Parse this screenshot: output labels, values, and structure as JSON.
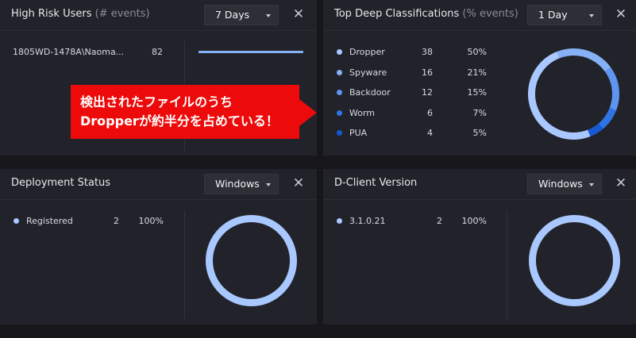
{
  "panels": {
    "high_risk": {
      "title": "High Risk Users",
      "subtitle": "(# events)",
      "dropdown": "7 Days",
      "rows": [
        {
          "user": "1805WD-1478A\\Naoma...",
          "value": "82",
          "bar_fraction": 1.0
        }
      ]
    },
    "deep_class": {
      "title": "Top Deep Classifications",
      "subtitle": "(% events)",
      "dropdown": "1 Day",
      "rows": [
        {
          "label": "Dropper",
          "count": "38",
          "pct": "50%",
          "color": "#a9c8ff"
        },
        {
          "label": "Spyware",
          "count": "16",
          "pct": "21%",
          "color": "#86b1f6"
        },
        {
          "label": "Backdoor",
          "count": "12",
          "pct": "15%",
          "color": "#5f95ee"
        },
        {
          "label": "Worm",
          "count": "6",
          "pct": "7%",
          "color": "#2f74e5"
        },
        {
          "label": "PUA",
          "count": "4",
          "pct": "5%",
          "color": "#1659d4"
        }
      ]
    },
    "deployment": {
      "title": "Deployment Status",
      "dropdown": "Windows",
      "rows": [
        {
          "label": "Registered",
          "count": "2",
          "pct": "100%",
          "color": "#a9c8ff"
        }
      ]
    },
    "dclient": {
      "title": "D-Client Version",
      "dropdown": "Windows",
      "rows": [
        {
          "label": "3.1.0.21",
          "count": "2",
          "pct": "100%",
          "color": "#a9c8ff"
        }
      ]
    }
  },
  "icons": {
    "close": "close-icon",
    "caret": "chevron-down-icon"
  },
  "callout": {
    "line1": "検出されたファイルのうち",
    "line2": "Dropperが約半分を占めている！"
  }
}
